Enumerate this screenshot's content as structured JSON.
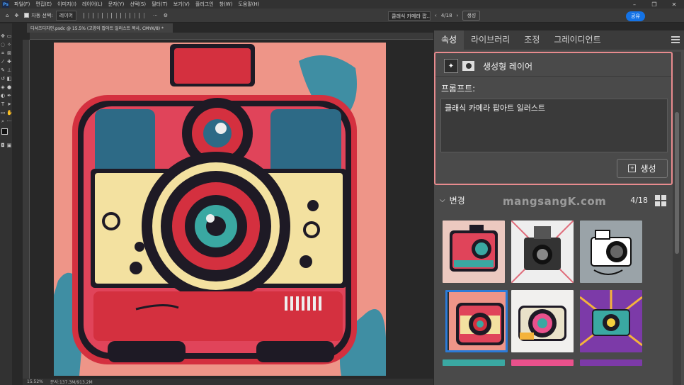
{
  "menubar": {
    "logo": "Ps",
    "items": [
      "파일(F)",
      "편집(E)",
      "이미지(I)",
      "레이어(L)",
      "문자(Y)",
      "선택(S)",
      "필터(T)",
      "보기(V)",
      "플러그인",
      "창(W)",
      "도움말(H)"
    ],
    "window_controls": [
      "–",
      "❐",
      "✕"
    ]
  },
  "optionsbar": {
    "auto_select_label": "자동 선택:",
    "auto_select_value": "레이어",
    "generate_input": "클래식 카메라 팝...",
    "nav": "4/18",
    "generate_button": "생성",
    "share_button": "공유",
    "more": "···"
  },
  "document": {
    "tab_title": "디셔즈디자인.psdc @ 15.5% (고양이 팝아트 일러스트 복사, CMYK/8) *",
    "zoom": "15.52%",
    "doc_info": "문서:137.3M/913.2M"
  },
  "panel": {
    "tabs": [
      "속성",
      "라이브러리",
      "조정",
      "그레이디언트"
    ],
    "layer_type": "생성형 레이어",
    "prompt_label": "프롬프트:",
    "prompt_text": "클래식 카메라 팝아트 일러스트",
    "generate_button": "생성",
    "variations_label": "변경",
    "variations_count": "4/18",
    "watermark": "mangsangK.com"
  },
  "colors": {
    "highlight": "#e88b8e",
    "accent": "#1473e6",
    "selected": "#2b7bd8",
    "artwork_bg": "#ee9588"
  }
}
